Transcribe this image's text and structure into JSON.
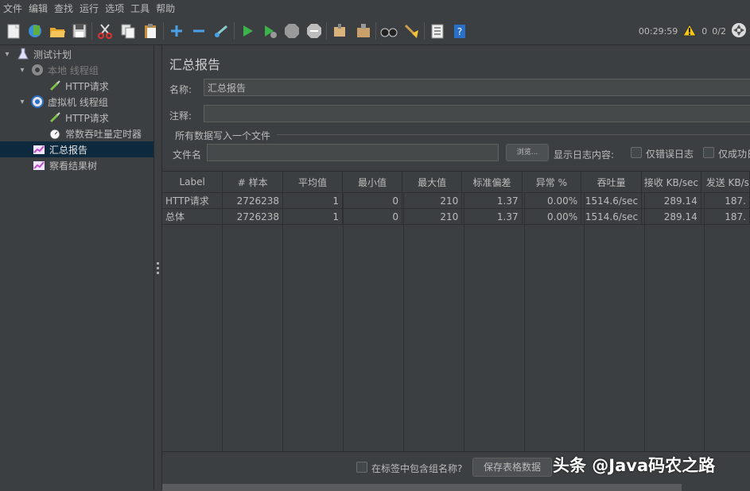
{
  "menu": [
    "文件",
    "编辑",
    "查找",
    "运行",
    "选项",
    "工具",
    "帮助"
  ],
  "status": {
    "timer": "00:29:59",
    "warnings": "0",
    "threads": "0/2"
  },
  "tree": [
    {
      "label": "测试计划"
    },
    {
      "label": "本地 线程组"
    },
    {
      "label": "HTTP请求"
    },
    {
      "label": "虚拟机 线程组"
    },
    {
      "label": "HTTP请求"
    },
    {
      "label": "常数吞吐量定时器"
    },
    {
      "label": "汇总报告"
    },
    {
      "label": "察看结果树"
    }
  ],
  "panel": {
    "title": "汇总报告",
    "name_label": "名称:",
    "name_value": "汇总报告",
    "comment_label": "注释:",
    "comment_value": "",
    "file_group": "所有数据写入一个文件",
    "file_label": "文件名",
    "file_value": "",
    "browse": "浏览...",
    "log_label": "显示日志内容:",
    "errors_only": "仅错误日志",
    "success_only": "仅成功日"
  },
  "table": {
    "headers": [
      "Label",
      "# 样本",
      "平均值",
      "最小值",
      "最大值",
      "标准偏差",
      "异常 %",
      "吞吐量",
      "接收 KB/sec",
      "发送 KB/s"
    ],
    "rows": [
      [
        "HTTP请求",
        "2726238",
        "1",
        "0",
        "210",
        "1.37",
        "0.00%",
        "1514.6/sec",
        "289.14",
        "187."
      ],
      [
        "总体",
        "2726238",
        "1",
        "0",
        "210",
        "1.37",
        "0.00%",
        "1514.6/sec",
        "289.14",
        "187."
      ]
    ]
  },
  "bottom": {
    "include_group": "在标签中包含组名称?",
    "save": "保存表格数据",
    "watermark": "头条 @Java码农之路"
  }
}
